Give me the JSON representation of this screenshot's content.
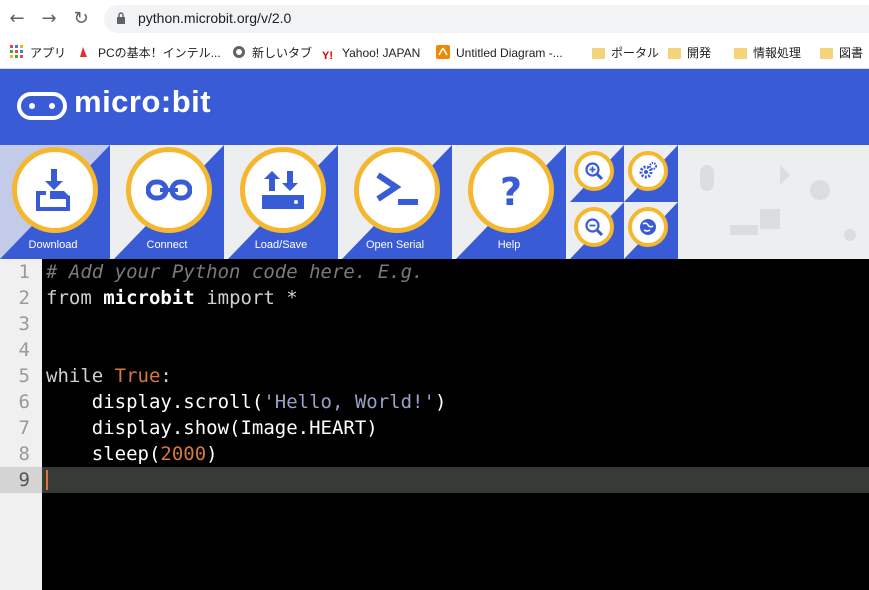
{
  "browser": {
    "url": "python.microbit.org/v/2.0",
    "bookmarks": [
      {
        "label": "アプリ",
        "icon": "apps-grid-icon"
      },
      {
        "label": "PCの基本！インテル...",
        "icon": "intel-favicon-icon"
      },
      {
        "label": "新しいタブ",
        "icon": "globe-icon"
      },
      {
        "label": "Yahoo! JAPAN",
        "icon": "yahoo-favicon-icon"
      },
      {
        "label": "Untitled Diagram -...",
        "icon": "drawio-favicon-icon"
      },
      {
        "label": "ポータル",
        "icon": "folder-icon"
      },
      {
        "label": "開発",
        "icon": "folder-icon"
      },
      {
        "label": "情報処理",
        "icon": "folder-icon"
      },
      {
        "label": "図書",
        "icon": "folder-icon"
      }
    ]
  },
  "header": {
    "logo_text": "micro:bit"
  },
  "toolbar": {
    "download": "Download",
    "connect": "Connect",
    "load_save": "Load/Save",
    "open_serial": "Open Serial",
    "help": "Help"
  },
  "editor": {
    "line_numbers": [
      "1",
      "2",
      "3",
      "4",
      "5",
      "6",
      "7",
      "8",
      "9"
    ],
    "lines": {
      "l1": "# Add your Python code here. E.g.",
      "l2_from": "from",
      "l2_module": "microbit",
      "l2_import": "import",
      "l2_star": "*",
      "l5_while": "while",
      "l5_true": "True",
      "l5_colon": ":",
      "l6_pre": "    display.scroll(",
      "l6_str": "'Hello, World!'",
      "l6_post": ")",
      "l7": "    display.show(Image.HEART)",
      "l8_pre": "    sleep(",
      "l8_num": "2000",
      "l8_post": ")"
    },
    "active_line": "9"
  },
  "colors": {
    "header_blue": "#3a5bd6",
    "accent_yellow": "#f5b72e",
    "editor_bg": "#000000"
  }
}
